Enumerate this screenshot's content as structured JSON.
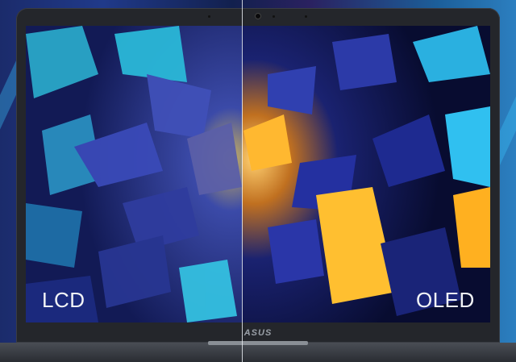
{
  "labels": {
    "left": "LCD",
    "right": "OLED"
  },
  "brand": {
    "logo": "ASUS"
  },
  "colors": {
    "lcd_cyan": "#2ab8d8",
    "lcd_blue": "#2a3aa0",
    "oled_gold": "#ffb020",
    "oled_blue": "#1d2a8a"
  }
}
